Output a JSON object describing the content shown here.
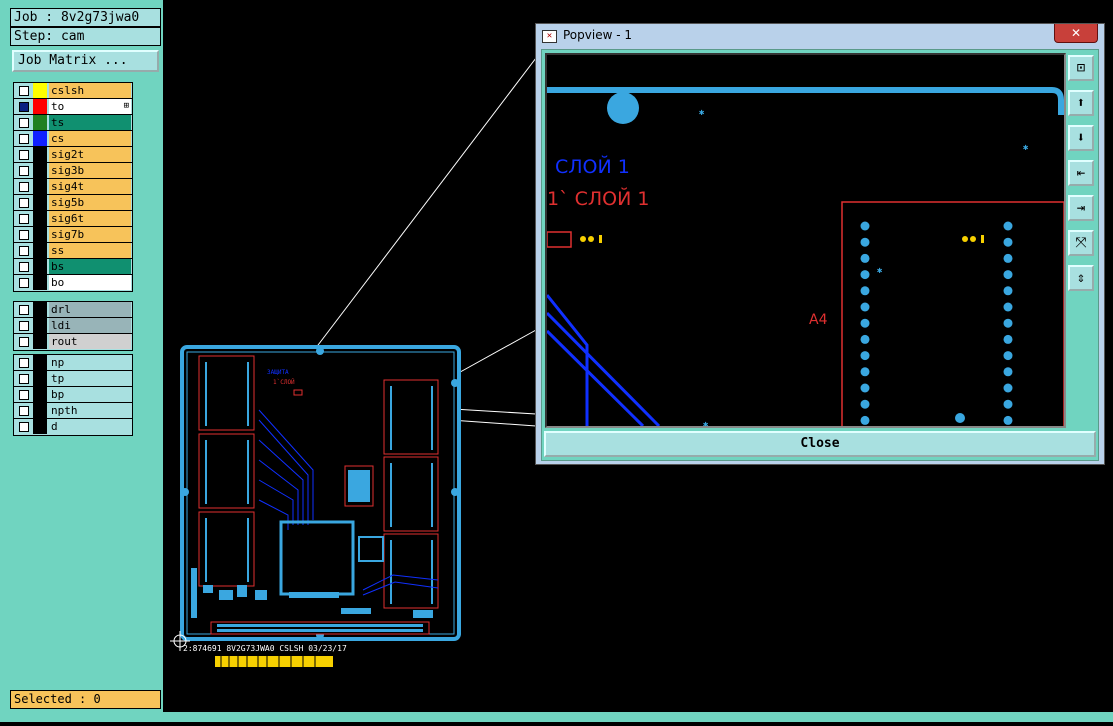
{
  "job": {
    "label": "Job : 8v2g73jwa0",
    "step": "Step: cam"
  },
  "job_matrix_button": "Job Matrix ...",
  "layer_groups": [
    [
      {
        "name": "cslsh",
        "color": "#f7c35a",
        "swatch": "#ffff00",
        "checked": false
      },
      {
        "name": "to",
        "color": "#ffffff",
        "swatch": "#ff0000",
        "checked": true,
        "marker": "⊞"
      },
      {
        "name": "ts",
        "color": "#109070",
        "swatch": "#208020",
        "checked": false
      },
      {
        "name": "cs",
        "color": "#f7c35a",
        "swatch": "#1020ff",
        "checked": false
      },
      {
        "name": "sig2t",
        "color": "#f7c35a",
        "checked": false
      },
      {
        "name": "sig3b",
        "color": "#f7c35a",
        "checked": false
      },
      {
        "name": "sig4t",
        "color": "#f7c35a",
        "checked": false
      },
      {
        "name": "sig5b",
        "color": "#f7c35a",
        "checked": false
      },
      {
        "name": "sig6t",
        "color": "#f7c35a",
        "checked": false
      },
      {
        "name": "sig7b",
        "color": "#f7c35a",
        "checked": false
      },
      {
        "name": "ss",
        "color": "#f7c35a",
        "checked": false
      },
      {
        "name": "bs",
        "color": "#109070",
        "checked": false
      },
      {
        "name": "bo",
        "color": "#ffffff",
        "checked": false
      }
    ],
    [
      {
        "name": "drl",
        "color": "#98b4b8",
        "checked": false
      },
      {
        "name": "ldi",
        "color": "#98b4b8",
        "checked": false
      },
      {
        "name": "rout",
        "color": "#d0d0d0",
        "checked": false
      }
    ],
    [
      {
        "name": "np",
        "color": "#a8e0e0",
        "checked": false
      },
      {
        "name": "tp",
        "color": "#a8e0e0",
        "checked": false
      },
      {
        "name": "bp",
        "color": "#a8e0e0",
        "checked": false
      },
      {
        "name": "npth",
        "color": "#a8e0e0",
        "checked": false
      },
      {
        "name": "d",
        "color": "#a8e0e0",
        "checked": false
      }
    ]
  ],
  "selected": "Selected : 0",
  "board_caption": "2:874691 8V2G73JWA0 CSLSH 03/23/17",
  "popview": {
    "title": "Popview - 1",
    "close_x": "✕",
    "close_button": "Close",
    "view_text_1": "СЛОЙ 1",
    "view_text_2": "1` СЛОЙ 1",
    "view_label_a4": "A4",
    "side_icons": [
      "zoom-fit-icon",
      "zoom-in-icon",
      "zoom-out-icon",
      "pan-left-icon",
      "pan-right-icon",
      "fit-all-icon",
      "expand-icon"
    ]
  },
  "colors": {
    "copper": "#3aa7e0",
    "outline": "#e03030",
    "trace": "#1030ff",
    "panel": "#70d4c0"
  }
}
